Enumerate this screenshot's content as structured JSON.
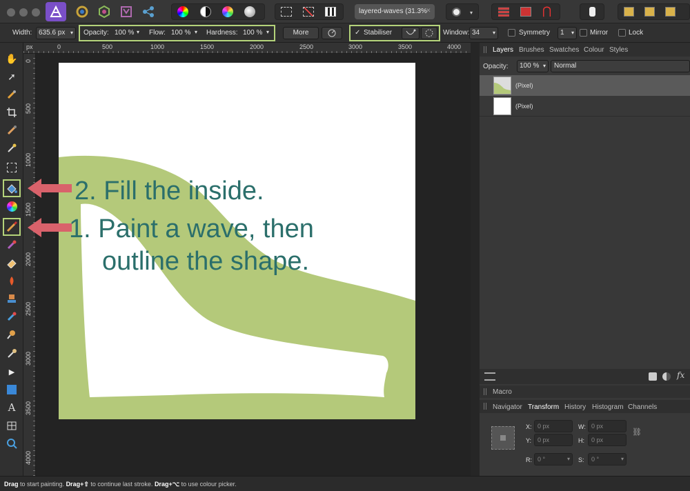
{
  "titlebar": {
    "document_name": "layered-waves (31.3%",
    "document_close": "✕"
  },
  "context_toolbar": {
    "width_label": "Width:",
    "width_value": "635.6 px",
    "opacity_label": "Opacity:",
    "opacity_value": "100 %",
    "flow_label": "Flow:",
    "flow_value": "100 %",
    "hardness_label": "Hardness:",
    "hardness_value": "100 %",
    "more_label": "More",
    "stabiliser_label": "Stabiliser",
    "window_label": "Window:",
    "window_value": "34",
    "symmetry_label": "Symmetry",
    "symmetry_value": "1",
    "mirror_label": "Mirror",
    "lock_label": "Lock"
  },
  "ruler": {
    "unit": "px",
    "top_ticks": [
      "0",
      "500",
      "1000",
      "1500",
      "2000",
      "2500",
      "3000",
      "3500",
      "4000"
    ],
    "left_ticks": [
      "0",
      "500",
      "1000",
      "1500",
      "2000",
      "2500",
      "3000",
      "3500",
      "4000"
    ]
  },
  "annotations": {
    "step2": "2. Fill the inside.",
    "step1_line1": "1. Paint a wave, then",
    "step1_line2": "outline the shape."
  },
  "right_panel": {
    "tabs": [
      "Layers",
      "Brushes",
      "Swatches",
      "Colour",
      "Styles"
    ],
    "opacity_label": "Opacity:",
    "opacity_value": "100 %",
    "blend_mode": "Normal",
    "layers": [
      {
        "name": "(Pixel)",
        "selected": true
      },
      {
        "name": "(Pixel)",
        "selected": false
      }
    ],
    "fx_label": "fx",
    "macro_label": "Macro",
    "bottom_tabs": [
      "Navigator",
      "Transform",
      "History",
      "Histogram",
      "Channels"
    ],
    "transform": {
      "x_label": "X:",
      "x_value": "0 px",
      "y_label": "Y:",
      "y_value": "0 px",
      "w_label": "W:",
      "w_value": "0 px",
      "h_label": "H:",
      "h_value": "0 px",
      "r_label": "R:",
      "r_value": "0 °",
      "s_label": "S:",
      "s_value": "0 °"
    }
  },
  "status": {
    "drag1": "Drag",
    "text1": " to start painting. ",
    "drag2": "Drag+⇧",
    "text2": " to continue last stroke. ",
    "drag3": "Drag+⌥",
    "text3": " to use colour picker."
  },
  "colors": {
    "wave_green": "#b4c97a",
    "highlight_green": "#b4d37a",
    "annotation_teal": "#2b6f6b",
    "arrow_red": "#d9626b"
  },
  "icons": [
    "hand-icon",
    "move-icon",
    "color-picker-icon",
    "crop-icon",
    "selection-brush-icon",
    "flood-select-icon",
    "marquee-icon",
    "flood-fill-icon",
    "gradient-icon",
    "paint-brush-icon",
    "color-replace-icon",
    "eraser-icon",
    "dodge-icon",
    "clone-icon",
    "healing-icon",
    "smudge-icon",
    "sponge-icon",
    "node-icon",
    "rectangle-icon",
    "text-icon",
    "mesh-warp-icon",
    "zoom-icon"
  ]
}
